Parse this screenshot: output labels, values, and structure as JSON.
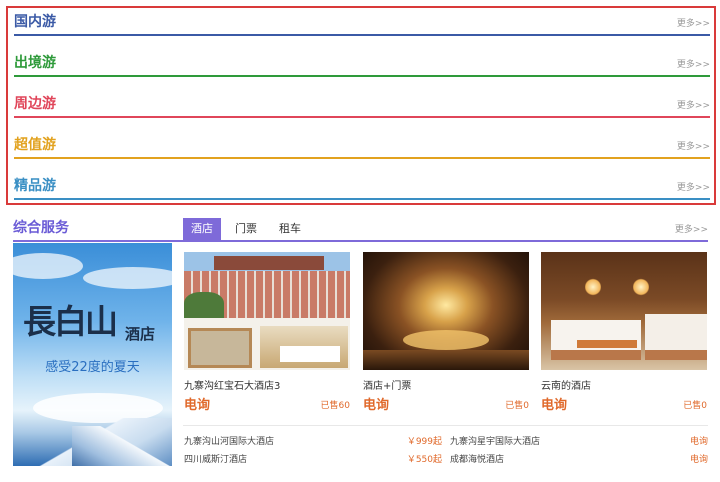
{
  "categories": [
    {
      "title": "国内游",
      "color": "#3b5aa6",
      "more": "更多>>"
    },
    {
      "title": "出境游",
      "color": "#2e9a3a",
      "more": "更多>>"
    },
    {
      "title": "周边游",
      "color": "#e0465a",
      "more": "更多>>"
    },
    {
      "title": "超值游",
      "color": "#e2a21f",
      "more": "更多>>"
    },
    {
      "title": "精品游",
      "color": "#3a8fc4",
      "more": "更多>>"
    }
  ],
  "services": {
    "title": "综合服务",
    "tabs": [
      "酒店",
      "门票",
      "租车"
    ],
    "more": "更多>>",
    "banner": {
      "logo": "長白山",
      "logo_sub": "酒店",
      "slogan": "感受22度的夏天"
    },
    "cards": [
      {
        "name": "九寨沟红宝石大酒店3",
        "price": "电询",
        "sold": "已售60"
      },
      {
        "name": "酒店+门票",
        "price": "电询",
        "sold": "已售0"
      },
      {
        "name": "云南的酒店",
        "price": "电询",
        "sold": "已售0"
      }
    ],
    "list": [
      {
        "name": "九寨沟山河国际大酒店",
        "price": "￥999起"
      },
      {
        "name": "九寨沟星宇国际大酒店",
        "price": "电询"
      },
      {
        "name": "四川威斯汀酒店",
        "price": "￥550起"
      },
      {
        "name": "成都海悦酒店",
        "price": "电询"
      }
    ]
  },
  "colors": {
    "highlight_border": "#d93a3a",
    "services_accent": "#7e6ad9",
    "price": "#e0692b"
  }
}
